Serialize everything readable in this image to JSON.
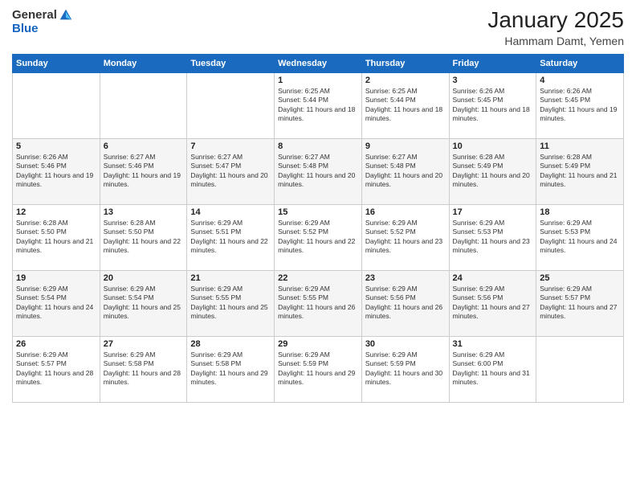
{
  "header": {
    "logo_general": "General",
    "logo_blue": "Blue",
    "month": "January 2025",
    "location": "Hammam Damt, Yemen"
  },
  "days_of_week": [
    "Sunday",
    "Monday",
    "Tuesday",
    "Wednesday",
    "Thursday",
    "Friday",
    "Saturday"
  ],
  "weeks": [
    [
      {
        "day": "",
        "info": ""
      },
      {
        "day": "",
        "info": ""
      },
      {
        "day": "",
        "info": ""
      },
      {
        "day": "1",
        "info": "Sunrise: 6:25 AM\nSunset: 5:44 PM\nDaylight: 11 hours and 18 minutes."
      },
      {
        "day": "2",
        "info": "Sunrise: 6:25 AM\nSunset: 5:44 PM\nDaylight: 11 hours and 18 minutes."
      },
      {
        "day": "3",
        "info": "Sunrise: 6:26 AM\nSunset: 5:45 PM\nDaylight: 11 hours and 18 minutes."
      },
      {
        "day": "4",
        "info": "Sunrise: 6:26 AM\nSunset: 5:45 PM\nDaylight: 11 hours and 19 minutes."
      }
    ],
    [
      {
        "day": "5",
        "info": "Sunrise: 6:26 AM\nSunset: 5:46 PM\nDaylight: 11 hours and 19 minutes."
      },
      {
        "day": "6",
        "info": "Sunrise: 6:27 AM\nSunset: 5:46 PM\nDaylight: 11 hours and 19 minutes."
      },
      {
        "day": "7",
        "info": "Sunrise: 6:27 AM\nSunset: 5:47 PM\nDaylight: 11 hours and 20 minutes."
      },
      {
        "day": "8",
        "info": "Sunrise: 6:27 AM\nSunset: 5:48 PM\nDaylight: 11 hours and 20 minutes."
      },
      {
        "day": "9",
        "info": "Sunrise: 6:27 AM\nSunset: 5:48 PM\nDaylight: 11 hours and 20 minutes."
      },
      {
        "day": "10",
        "info": "Sunrise: 6:28 AM\nSunset: 5:49 PM\nDaylight: 11 hours and 20 minutes."
      },
      {
        "day": "11",
        "info": "Sunrise: 6:28 AM\nSunset: 5:49 PM\nDaylight: 11 hours and 21 minutes."
      }
    ],
    [
      {
        "day": "12",
        "info": "Sunrise: 6:28 AM\nSunset: 5:50 PM\nDaylight: 11 hours and 21 minutes."
      },
      {
        "day": "13",
        "info": "Sunrise: 6:28 AM\nSunset: 5:50 PM\nDaylight: 11 hours and 22 minutes."
      },
      {
        "day": "14",
        "info": "Sunrise: 6:29 AM\nSunset: 5:51 PM\nDaylight: 11 hours and 22 minutes."
      },
      {
        "day": "15",
        "info": "Sunrise: 6:29 AM\nSunset: 5:52 PM\nDaylight: 11 hours and 22 minutes."
      },
      {
        "day": "16",
        "info": "Sunrise: 6:29 AM\nSunset: 5:52 PM\nDaylight: 11 hours and 23 minutes."
      },
      {
        "day": "17",
        "info": "Sunrise: 6:29 AM\nSunset: 5:53 PM\nDaylight: 11 hours and 23 minutes."
      },
      {
        "day": "18",
        "info": "Sunrise: 6:29 AM\nSunset: 5:53 PM\nDaylight: 11 hours and 24 minutes."
      }
    ],
    [
      {
        "day": "19",
        "info": "Sunrise: 6:29 AM\nSunset: 5:54 PM\nDaylight: 11 hours and 24 minutes."
      },
      {
        "day": "20",
        "info": "Sunrise: 6:29 AM\nSunset: 5:54 PM\nDaylight: 11 hours and 25 minutes."
      },
      {
        "day": "21",
        "info": "Sunrise: 6:29 AM\nSunset: 5:55 PM\nDaylight: 11 hours and 25 minutes."
      },
      {
        "day": "22",
        "info": "Sunrise: 6:29 AM\nSunset: 5:55 PM\nDaylight: 11 hours and 26 minutes."
      },
      {
        "day": "23",
        "info": "Sunrise: 6:29 AM\nSunset: 5:56 PM\nDaylight: 11 hours and 26 minutes."
      },
      {
        "day": "24",
        "info": "Sunrise: 6:29 AM\nSunset: 5:56 PM\nDaylight: 11 hours and 27 minutes."
      },
      {
        "day": "25",
        "info": "Sunrise: 6:29 AM\nSunset: 5:57 PM\nDaylight: 11 hours and 27 minutes."
      }
    ],
    [
      {
        "day": "26",
        "info": "Sunrise: 6:29 AM\nSunset: 5:57 PM\nDaylight: 11 hours and 28 minutes."
      },
      {
        "day": "27",
        "info": "Sunrise: 6:29 AM\nSunset: 5:58 PM\nDaylight: 11 hours and 28 minutes."
      },
      {
        "day": "28",
        "info": "Sunrise: 6:29 AM\nSunset: 5:58 PM\nDaylight: 11 hours and 29 minutes."
      },
      {
        "day": "29",
        "info": "Sunrise: 6:29 AM\nSunset: 5:59 PM\nDaylight: 11 hours and 29 minutes."
      },
      {
        "day": "30",
        "info": "Sunrise: 6:29 AM\nSunset: 5:59 PM\nDaylight: 11 hours and 30 minutes."
      },
      {
        "day": "31",
        "info": "Sunrise: 6:29 AM\nSunset: 6:00 PM\nDaylight: 11 hours and 31 minutes."
      },
      {
        "day": "",
        "info": ""
      }
    ]
  ]
}
